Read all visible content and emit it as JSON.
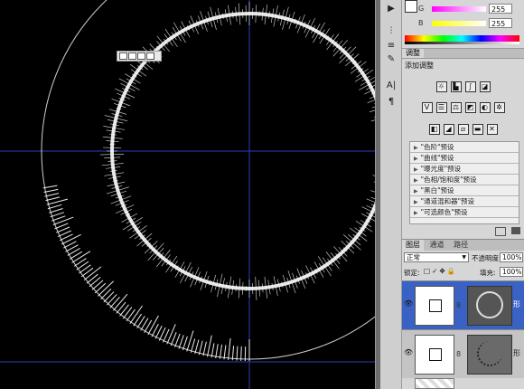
{
  "colors": {
    "canvas_bg": "#000000",
    "guide": "#2a3fbf",
    "glow": "#ffffff",
    "selected_layer": "#3a62c4"
  },
  "color_panel": {
    "g_label": "G",
    "g_value": "255",
    "b_label": "B",
    "b_value": "255"
  },
  "adjustments_panel": {
    "tab": "调整",
    "subtitle": "添加调整",
    "presets": [
      "\"色阶\"预设",
      "\"曲线\"预设",
      "\"曝光度\"预设",
      "\"色相/饱和度\"预设",
      "\"黑白\"预设",
      "\"通道混和器\"预设",
      "\"可选颜色\"预设"
    ]
  },
  "layers_panel": {
    "tabs": [
      "图层",
      "通道",
      "路径"
    ],
    "blend_mode": "正常",
    "opacity_label": "不透明度:",
    "opacity_value": "100%",
    "lock_label": "锁定:",
    "fill_label": "填充:",
    "fill_value": "100%",
    "layers": [
      {
        "name": "形"
      },
      {
        "name": "形"
      }
    ]
  },
  "icons": [
    "move-icon",
    "eye-icon",
    "link-icon",
    "lock-icon",
    "text-tool-icon",
    "paragraph-icon",
    "brush-icon"
  ]
}
